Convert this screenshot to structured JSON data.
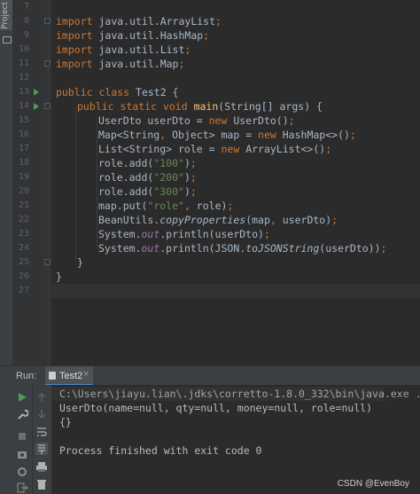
{
  "sidebar": {
    "project_tab_label": "Project"
  },
  "editor": {
    "line_numbers": [
      "7",
      "8",
      "9",
      "10",
      "11",
      "12",
      "13",
      "14",
      "15",
      "16",
      "17",
      "18",
      "19",
      "20",
      "21",
      "22",
      "23",
      "24",
      "25",
      "26",
      "27"
    ],
    "code": {
      "l8": [
        "import",
        " java.util.ArrayList",
        ";"
      ],
      "l9": [
        "import",
        " java.util.HashMap",
        ";"
      ],
      "l10": [
        "import",
        " java.util.List",
        ";"
      ],
      "l11": [
        "import",
        " java.util.Map",
        ";"
      ],
      "l13": [
        "public class",
        " Test2 {"
      ],
      "l14": [
        "public static void",
        " ",
        "main",
        "(String[] args) {"
      ],
      "l15": [
        "UserDto userDto = ",
        "new",
        " UserDto()",
        ";"
      ],
      "l16": [
        "Map<String",
        ", ",
        "Object> map = ",
        "new",
        " HashMap<>()",
        ";"
      ],
      "l17": [
        "List<String> role = ",
        "new",
        " ArrayList<>()",
        ";"
      ],
      "l18": [
        "role.add(",
        "\"100\"",
        ")",
        ";"
      ],
      "l19": [
        "role.add(",
        "\"200\"",
        ")",
        ";"
      ],
      "l20": [
        "role.add(",
        "\"300\"",
        ")",
        ";"
      ],
      "l21": [
        "map.put(",
        "\"role\"",
        ", ",
        "role)",
        ";"
      ],
      "l22": [
        "BeanUtils.",
        "copyProperties",
        "(map",
        ", ",
        "userDto)",
        ";"
      ],
      "l23": [
        "System.",
        "out",
        ".println(userDto)",
        ";"
      ],
      "l24": [
        "System.",
        "out",
        ".println(JSON.",
        "toJSONString",
        "(userDto))",
        ";"
      ],
      "l25": [
        "}"
      ],
      "l26": [
        "}"
      ]
    }
  },
  "run_panel": {
    "run_label": "Run:",
    "tab_label": "Test2",
    "tab_close": "×",
    "console_lines": [
      "C:\\Users\\jiayu.lian\\.jdks\\corretto-1.8.0_332\\bin\\java.exe ...",
      "UserDto(name=null, qty=null, money=null, role=null)",
      "{}",
      "",
      "Process finished with exit code 0"
    ]
  },
  "watermark": "CSDN @EvenBoy",
  "colors": {
    "keyword": "#cc7832",
    "method": "#ffc66d",
    "string": "#6a8759",
    "static_field": "#9876aa",
    "run_green": "#499c54"
  },
  "icons": [
    "run-icon",
    "wrench-icon",
    "stop-icon",
    "camera-icon",
    "exit-icon",
    "up-arrow-icon",
    "down-arrow-icon",
    "soft-wrap-icon",
    "scroll-to-end-icon",
    "print-icon",
    "trash-icon",
    "pin-icon"
  ]
}
